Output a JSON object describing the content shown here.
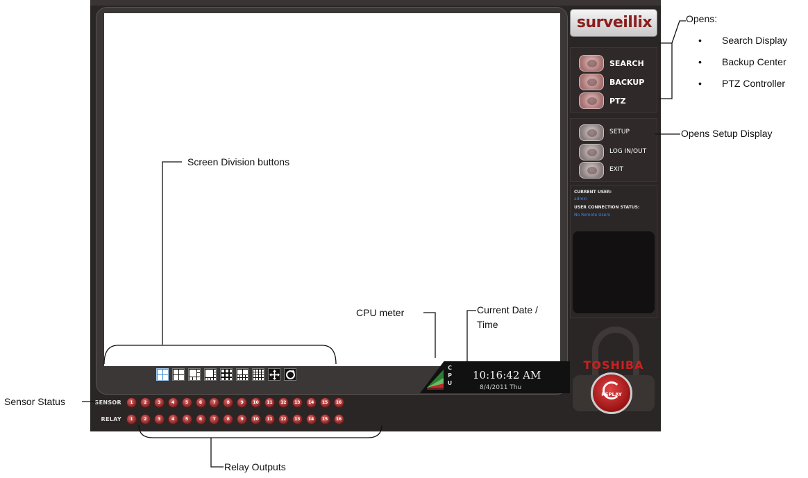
{
  "callouts": {
    "opens": "Opens:",
    "opens_items": [
      "Search Display",
      "Backup Center",
      "PTZ Controller"
    ],
    "opens_setup": "Opens Setup Display",
    "screen_division": "Screen Division buttons",
    "cpu_meter": "CPU meter",
    "current_date_time_line1": "Current Date /",
    "current_date_time_line2": "Time",
    "sensor_status": "Sensor Status",
    "relay_outputs": "Relay Outputs"
  },
  "app": {
    "brand_logo": "surveillix",
    "nav_primary": [
      "SEARCH",
      "BACKUP",
      "PTZ"
    ],
    "nav_secondary": [
      "SETUP",
      "LOG IN/OUT",
      "EXIT"
    ],
    "status": {
      "current_user_label": "CURRENT USER:",
      "current_user_value": "admin",
      "connection_label": "USER CONNECTION STATUS:",
      "connection_value": "No Remote Users"
    },
    "brand_name": "TOSHIBA",
    "replay_label": "REPLAY",
    "cpu_letters": [
      "C",
      "P",
      "U"
    ],
    "clock": {
      "time": "10:16:42 AM",
      "date": "8/4/2011 Thu"
    },
    "division_buttons": [
      "1-split",
      "4-split",
      "6-split",
      "8-split",
      "9-split",
      "10-split",
      "16-split",
      "fullscreen",
      "sequence"
    ],
    "sensor_label": "SENSOR",
    "relay_label": "RELAY",
    "channels": [
      "1",
      "2",
      "3",
      "4",
      "5",
      "6",
      "7",
      "8",
      "9",
      "10",
      "11",
      "12",
      "13",
      "14",
      "15",
      "16"
    ]
  },
  "colors": {
    "frame": "#2a2625",
    "accent_blue": "#3b87e0",
    "led_red": "#8a2424",
    "brand_red": "#cc2020"
  }
}
